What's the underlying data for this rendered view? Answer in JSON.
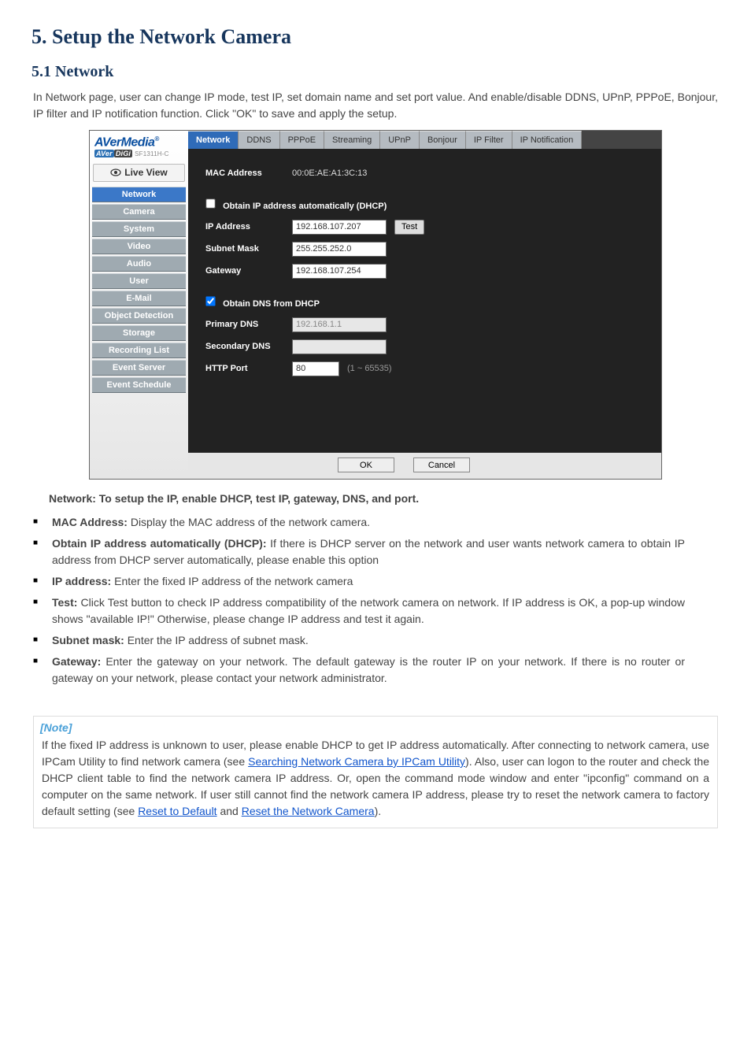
{
  "doc": {
    "h1": "5. Setup the Network Camera",
    "h2": "5.1  Network",
    "p1": "In Network page, user can change IP mode, test IP, set domain name and set port value. And enable/disable DDNS, UPnP, PPPoE, Bonjour, IP filter and IP notification function. Click \"OK\" to save and apply the setup.",
    "p_net": "Network: To setup the IP, enable DHCP, test IP, gateway, DNS, and port.",
    "bullets": {
      "mac": {
        "b": "MAC Address: ",
        "t": "Display the MAC address of the network camera."
      },
      "dhcp": {
        "b": "Obtain IP address automatically (DHCP): ",
        "t": "If there is DHCP server on the network and user wants network camera to obtain IP address from DHCP server automatically, please enable this option"
      },
      "ip": {
        "b": "IP address: ",
        "t": "Enter the fixed IP address of the network camera"
      },
      "test": {
        "b": "Test: ",
        "t": "Click Test button to check IP address compatibility of the network camera on network. If IP address is OK, a pop-up window shows \"available IP!\" Otherwise, please change IP address and test it again."
      },
      "sub": {
        "b": "Subnet mask: ",
        "t": "Enter the IP address of subnet mask."
      },
      "gw": {
        "b": "Gateway: ",
        "t": "Enter the gateway on your network. The default gateway is the router IP on your network. If there is no router or gateway on your network, please contact your network administrator."
      }
    },
    "note": {
      "hdr": "[Note]",
      "body": "If the fixed IP address is unknown to user, please enable DHCP to get IP address automatically. After connecting to network camera, use IPCam Utility to find network camera (see Searching Network Camera by IPCam Utility). Also, user can logon to the router and check the DHCP client table to find the network camera IP address. Or, open the command mode window and enter \"ipconfig\" command on a computer on the same network. If user still cannot find the network camera IP address, please try to reset the network camera to factory default setting (see Reset to Default and Reset the Network Camera).",
      "links": {
        "l1": "Searching Network Camera by IPCam Utility",
        "l2": "Reset to Default",
        "and": " and ",
        "l3": "Reset the Network Camera"
      }
    }
  },
  "ss": {
    "logo": {
      "brand1": "AVer",
      "brand2": "Media",
      "tag_a": "AVer",
      "tag_b": "DiGi",
      "model": "SF1311H-C"
    },
    "live": "Live View",
    "nav": [
      "Network",
      "Camera",
      "System",
      "Video",
      "Audio",
      "User",
      "E-Mail",
      "Object Detection",
      "Storage",
      "Recording List",
      "Event Server",
      "Event Schedule"
    ],
    "tabs": [
      "Network",
      "DDNS",
      "PPPoE",
      "Streaming",
      "UPnP",
      "Bonjour",
      "IP Filter",
      "IP Notification"
    ],
    "labels": {
      "mac": "MAC Address",
      "dhcp": "Obtain IP address automatically (DHCP)",
      "ip": "IP Address",
      "sub": "Subnet Mask",
      "gw": "Gateway",
      "dns_dhcp": "Obtain DNS from DHCP",
      "pdns": "Primary DNS",
      "sdns": "Secondary DNS",
      "http": "HTTP Port"
    },
    "values": {
      "mac": "00:0E:AE:A1:3C:13",
      "ip": "192.168.107.207",
      "sub": "255.255.252.0",
      "gw": "192.168.107.254",
      "pdns": "192.168.1.1",
      "sdns": "",
      "http": "80",
      "test": "Test",
      "port_hint": "(1 ~ 65535)"
    },
    "foot": {
      "ok": "OK",
      "cancel": "Cancel"
    }
  }
}
